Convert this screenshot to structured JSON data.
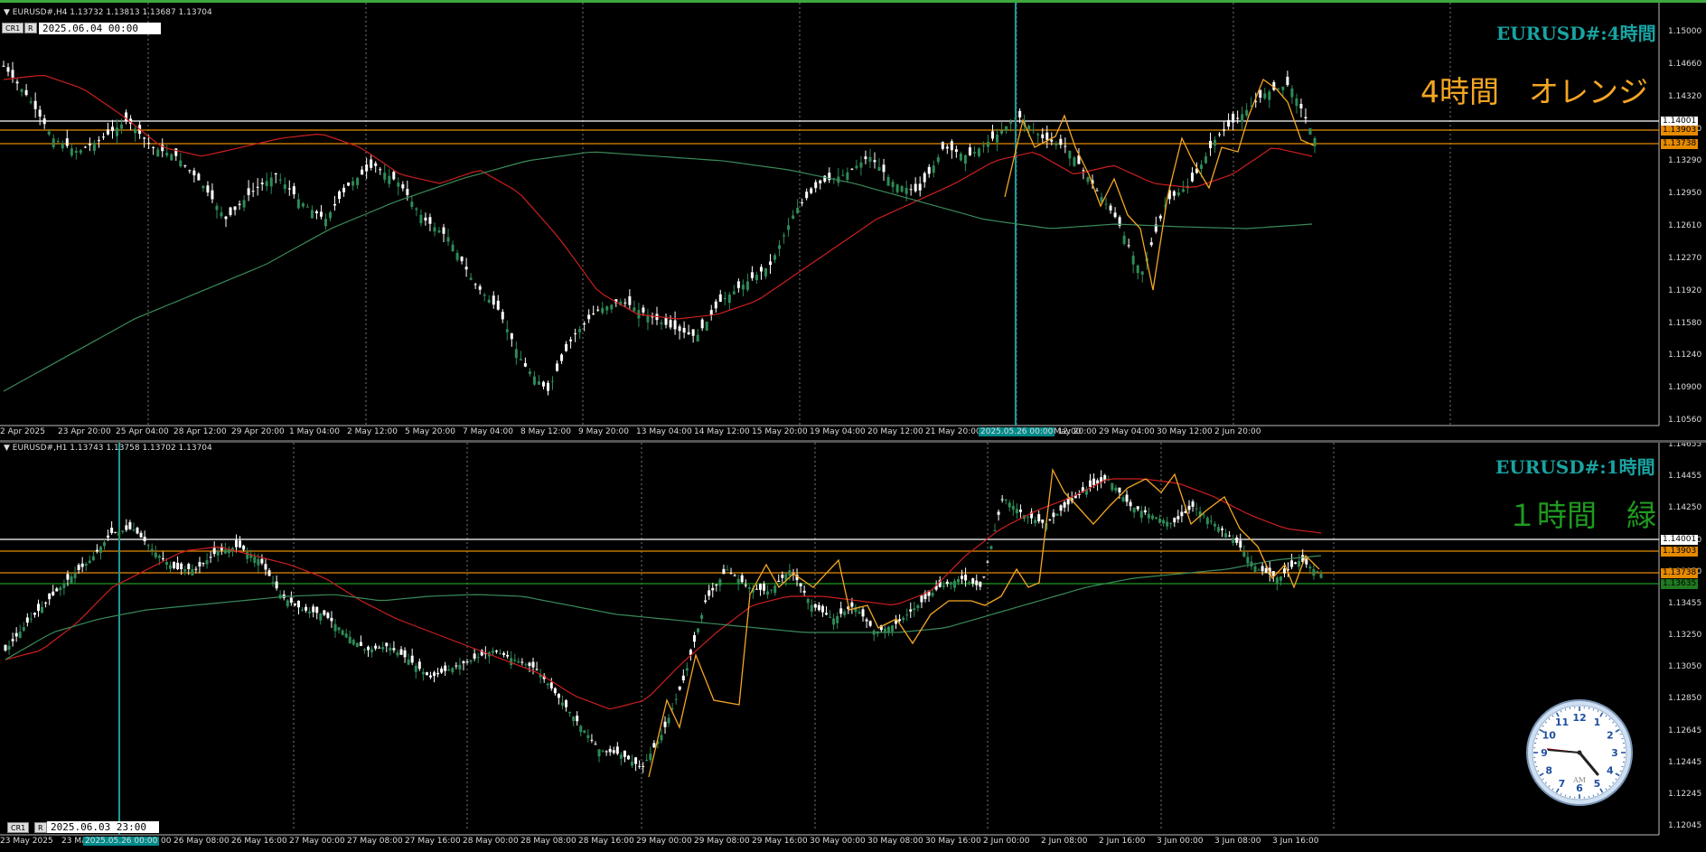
{
  "top": {
    "symbol_line": "EURUSD#,H4  1.13732 1.13813 1.13687 1.13704",
    "btn_cr": "CR1",
    "btn_r": "R",
    "datetime_box": "2025.06.04 00:00",
    "title": "EURUSD#:4時間",
    "note": "4時間　オレンジ",
    "y_labels": [
      "1.15000",
      "1.14660",
      "1.14320",
      "1.13640",
      "1.13290",
      "1.12950",
      "1.12610",
      "1.12270",
      "1.11920",
      "1.11580",
      "1.11240",
      "1.10900",
      "1.10560"
    ],
    "price_labels": [
      "1.14001",
      "1.13903",
      "1.13738"
    ],
    "x_labels": [
      "2 Apr 2025",
      "23 Apr 20:00",
      "25 Apr 04:00",
      "28 Apr 12:00",
      "29 Apr 20:00",
      "1 May 04:00",
      "2 May 12:00",
      "5 May 20:00",
      "7 May 04:00",
      "8 May 12:00",
      "9 May 20:00",
      "13 May 04:00",
      "14 May 12:00",
      "15 May 20:00",
      "19 May 04:00",
      "20 May 12:00",
      "21 May 20:00",
      "May 12:00",
      "27 May 20:00",
      "29 May 04:00",
      "30 May 12:00",
      "2 Jun 20:00"
    ],
    "x_highlight": "2025.05.26 00:00"
  },
  "bottom": {
    "symbol_line": "EURUSD#,H1  1.13743 1.13758 1.13702 1.13704",
    "btn_cr": "CR1",
    "btn_r": "R",
    "datetime_box": "2025.06.03 23:00",
    "title": "EURUSD#:1時間",
    "note": "１時間　緑",
    "y_labels": [
      "1.14655",
      "1.14455",
      "1.14250",
      "1.14050",
      "1.13850",
      "1.13455",
      "1.13250",
      "1.13050",
      "1.12850",
      "1.12645",
      "1.12445",
      "1.12245",
      "1.12045"
    ],
    "price_labels": [
      "1.14001",
      "1.13903",
      "1.13738",
      "1.13635"
    ],
    "x_labels": [
      "23 May 2025",
      "23 Ma",
      "00",
      "26 May 08:00",
      "26 May 16:00",
      "27 May 00:00",
      "27 May 08:00",
      "27 May 16:00",
      "28 May 00:00",
      "28 May 08:00",
      "28 May 16:00",
      "29 May 00:00",
      "29 May 08:00",
      "29 May 16:00",
      "30 May 00:00",
      "30 May 08:00",
      "30 May 16:00",
      "2 Jun 00:00",
      "2 Jun 08:00",
      "2 Jun 16:00",
      "3 Jun 00:00",
      "3 Jun 08:00",
      "3 Jun 16:00"
    ],
    "x_highlight": "2025.05.26 00:00"
  },
  "clock": {
    "am_label": "AM",
    "numerals": [
      "12",
      "1",
      "2",
      "3",
      "4",
      "5",
      "6",
      "7",
      "8",
      "9",
      "10",
      "11"
    ]
  },
  "colors": {
    "bull": "#2e8b57",
    "bear": "#ffffff",
    "ma_red": "#cc1f1f",
    "ma_green": "#3a8a5a",
    "zigzag": "#f5a623",
    "title_teal": "#1aa3a3",
    "note_orange": "#f5a623",
    "note_green": "#1f9a1f",
    "orange_line": "#e68a00",
    "cyan_vline": "#1a9a9a"
  }
}
